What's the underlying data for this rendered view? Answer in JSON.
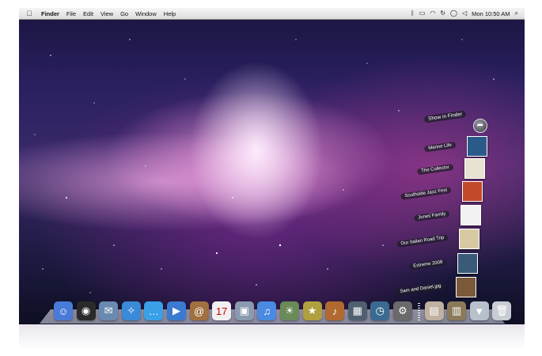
{
  "menubar": {
    "apple_icon": "apple-logo-icon",
    "app_name": "Finder",
    "menus": [
      "File",
      "Edit",
      "View",
      "Go",
      "Window",
      "Help"
    ],
    "status_icons": [
      "bluetooth-icon",
      "battery-icon",
      "wifi-icon",
      "sync-icon",
      "chat-icon",
      "volume-icon"
    ],
    "clock": "Mon 10:50 AM",
    "spotlight_icon": "spotlight-search-icon"
  },
  "stack": {
    "show_in_finder": "Show in Finder",
    "items": [
      {
        "label": "Marine Life",
        "color": "#2a5a8a"
      },
      {
        "label": "The Collector",
        "color": "#e8e2d0"
      },
      {
        "label": "Southside Jazz Fest",
        "color": "#c24a2a"
      },
      {
        "label": "Jones Family",
        "color": "#f2f2f2"
      },
      {
        "label": "Our Italian Road Trip",
        "color": "#d8c9a4"
      },
      {
        "label": "Extreme 2008",
        "color": "#3a5a7a"
      },
      {
        "label": "Sam and Daniel.jpg",
        "color": "#7a5a3a"
      }
    ]
  },
  "dock": {
    "apps": [
      {
        "name": "finder-icon",
        "glyph": "☺",
        "bg": "#4a7ad8"
      },
      {
        "name": "dashboard-icon",
        "glyph": "◉",
        "bg": "#2a2a2a"
      },
      {
        "name": "mail-icon",
        "glyph": "✉",
        "bg": "#6a8ab0"
      },
      {
        "name": "safari-icon",
        "glyph": "✧",
        "bg": "#3a8ad8"
      },
      {
        "name": "ichat-icon",
        "glyph": "…",
        "bg": "#3aa0e8"
      },
      {
        "name": "ichat-video-icon",
        "glyph": "▶",
        "bg": "#3a7ad0"
      },
      {
        "name": "address-book-icon",
        "glyph": "@",
        "bg": "#a07040"
      },
      {
        "name": "ical-icon",
        "glyph": "17",
        "bg": "#f0f0f0"
      },
      {
        "name": "preview-icon",
        "glyph": "▣",
        "bg": "#8a9ab0"
      },
      {
        "name": "itunes-icon",
        "glyph": "♫",
        "bg": "#4a8ae0"
      },
      {
        "name": "iphoto-icon",
        "glyph": "☀",
        "bg": "#6a8a5a"
      },
      {
        "name": "imovie-icon",
        "glyph": "★",
        "bg": "#b0a040"
      },
      {
        "name": "garageband-icon",
        "glyph": "♪",
        "bg": "#b06a30"
      },
      {
        "name": "spaces-icon",
        "glyph": "▦",
        "bg": "#506070"
      },
      {
        "name": "time-machine-icon",
        "glyph": "◷",
        "bg": "#3a6a90"
      },
      {
        "name": "system-preferences-icon",
        "glyph": "⚙",
        "bg": "#6a6a6a"
      }
    ],
    "docs": [
      {
        "name": "pictures-stack-icon",
        "glyph": "▤",
        "bg": "#c0b0a0"
      },
      {
        "name": "documents-stack-icon",
        "glyph": "▥",
        "bg": "#8a7a5a"
      },
      {
        "name": "downloads-stack-icon",
        "glyph": "▼",
        "bg": "#b8c0cc"
      },
      {
        "name": "trash-icon",
        "glyph": "🗑",
        "bg": "#c8ccd4"
      }
    ]
  }
}
